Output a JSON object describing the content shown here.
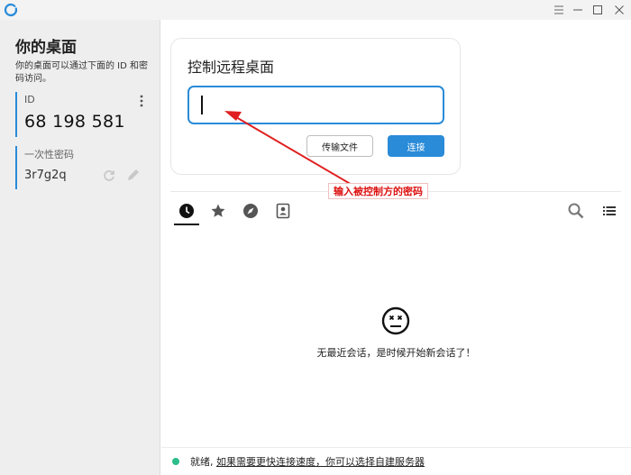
{
  "titlebar": {
    "controls": [
      "menu",
      "minimize",
      "maximize",
      "close"
    ]
  },
  "sidebar": {
    "title": "你的桌面",
    "description": "你的桌面可以通过下面的 ID 和密码访问。",
    "id_label": "ID",
    "id_value": "68 198 581",
    "password_label": "一次性密码",
    "password_value": "3r7g2q"
  },
  "connect": {
    "title": "控制远程桌面",
    "input_value": "",
    "transfer_button": "传输文件",
    "connect_button": "连接"
  },
  "tabs": [
    {
      "name": "recent",
      "icon": "clock-icon",
      "active": true
    },
    {
      "name": "favorites",
      "icon": "star-icon",
      "active": false
    },
    {
      "name": "discovered",
      "icon": "compass-icon",
      "active": false
    },
    {
      "name": "address-book",
      "icon": "contacts-icon",
      "active": false
    }
  ],
  "sessions": {
    "empty_text": "无最近会话，是时候开始新会话了！"
  },
  "status": {
    "ready": "就绪,",
    "link_text": "如果需要更快连接速度，你可以选择自建服务器"
  },
  "annotation": {
    "text": "输入被控制方的密码",
    "color": "#e02020"
  },
  "colors": {
    "accent": "#2a8bd8",
    "status_ok": "#2bbd8a"
  }
}
